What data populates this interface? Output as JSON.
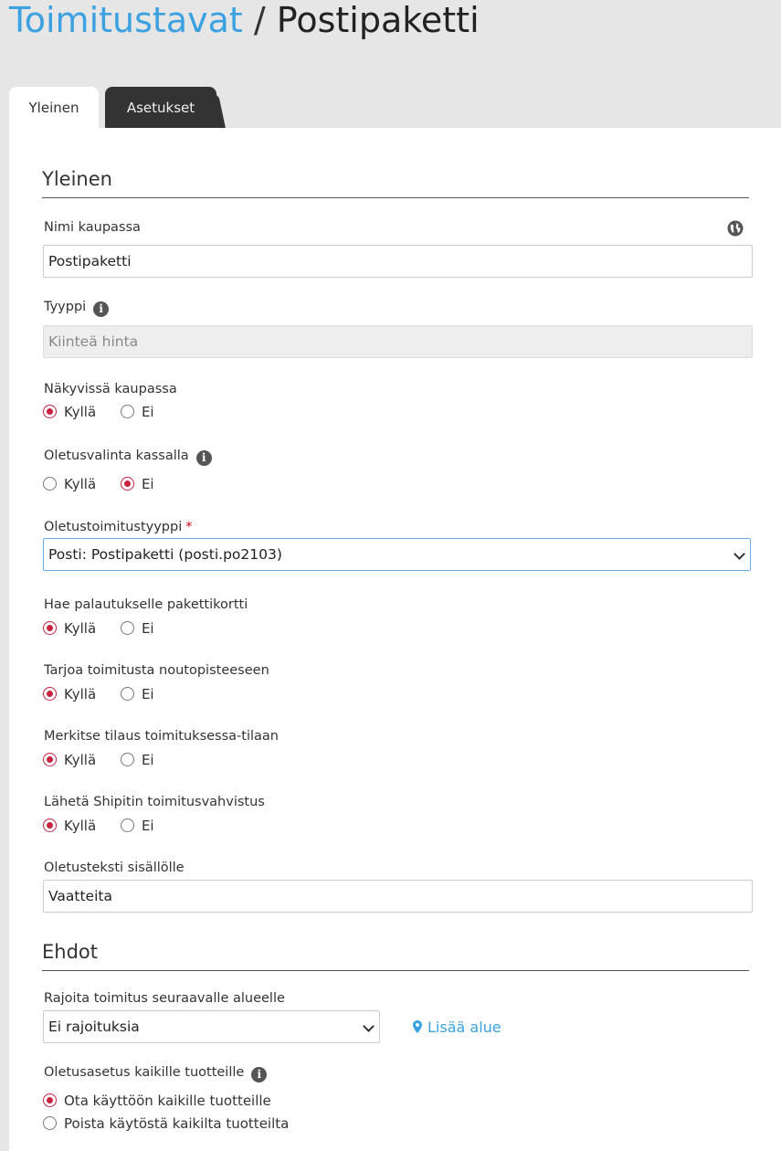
{
  "breadcrumb": {
    "parent": "Toimitustavat",
    "separator": "/",
    "current": "Postipaketti"
  },
  "tabs": {
    "general": "Yleinen",
    "settings": "Asetukset"
  },
  "general": {
    "title": "Yleinen",
    "name_label": "Nimi kaupassa",
    "name_value": "Postipaketti",
    "type_label": "Tyyppi",
    "type_value": "Kiinteä hinta",
    "visible_label": "Näkyvissä kaupassa",
    "default_checkout_label": "Oletusvalinta kassalla",
    "default_type_label": "Oletustoimitustyyppi",
    "required_mark": "*",
    "default_type_value": "Posti: Postipaketti (posti.po2103)",
    "return_card_label": "Hae palautukselle pakettikortti",
    "pickup_label": "Tarjoa toimitusta noutopisteeseen",
    "mark_status_label": "Merkitse tilaus toimituksessa-tilaan",
    "shipit_label": "Lähetä Shipitin toimitusvahvistus",
    "content_text_label": "Oletusteksti sisällölle",
    "content_text_value": "Vaatteita"
  },
  "radio": {
    "yes": "Kyllä",
    "no": "Ei"
  },
  "conditions": {
    "title": "Ehdot",
    "region_label": "Rajoita toimitus seuraavalle alueelle",
    "region_value": "Ei rajoituksia",
    "add_region": "Lisää alue",
    "products_label": "Oletusasetus kaikille tuotteille",
    "enable_all": "Ota käyttöön kaikille tuotteille",
    "disable_all": "Poista käytöstä kaikilta tuotteilta"
  },
  "icons": [
    "globe-icon",
    "info-icon",
    "chevron-down-icon",
    "map-marker-icon"
  ],
  "colors": {
    "accent": "#3ba1e0",
    "radio_selected": "#c8233f",
    "tab_dark": "#333333"
  }
}
